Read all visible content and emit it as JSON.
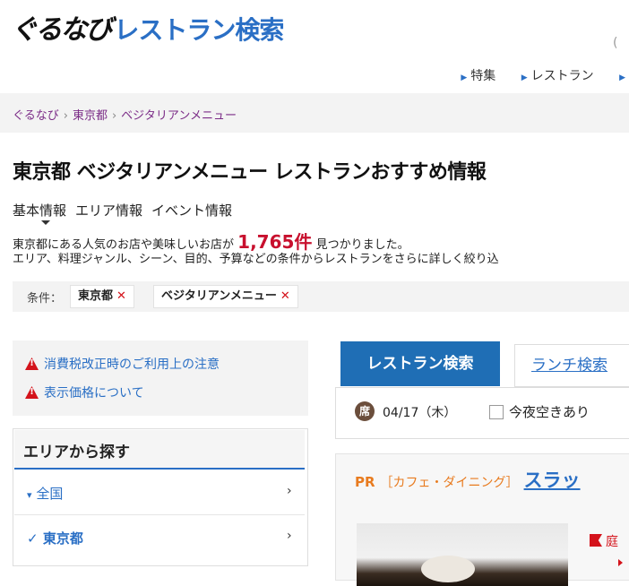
{
  "logo": {
    "brand": "ぐるなび",
    "title": "レストラン検索"
  },
  "topnav": {
    "items": [
      "特集",
      "レストラン"
    ]
  },
  "breadcrumb": [
    "ぐるなび",
    "東京都",
    "ベジタリアンメニュー"
  ],
  "page_title": "東京都 ベジタリアンメニュー レストランおすすめ情報",
  "info_tabs": [
    "基本情報",
    "エリア情報",
    "イベント情報"
  ],
  "result": {
    "prefix": "東京都にある人気のお店や美味しいお店が",
    "count": "1,765件",
    "suffix": "見つかりました。",
    "line2": "エリア、料理ジャンル、シーン、目的、予算などの条件からレストランをさらに詳しく絞り込"
  },
  "conditions": {
    "label": "条件：",
    "chips": [
      "東京都",
      "ベジタリアンメニュー"
    ],
    "remove_glyph": "✕"
  },
  "notices": [
    "消費税改正時のご利用上の注意",
    "表示価格について"
  ],
  "area_panel": {
    "heading": "エリアから探す",
    "items": [
      {
        "mark": "▾",
        "label": "全国"
      },
      {
        "mark": "✓",
        "label": "東京都"
      }
    ],
    "chevron": "›"
  },
  "search_tabs": {
    "active": "レストラン検索",
    "lunch": "ランチ検索"
  },
  "date_row": {
    "badge": "席",
    "date": "04/17（木）",
    "tonight_label": "今夜空きあり"
  },
  "pr_card": {
    "tag": "PR",
    "category": "［カフェ・ダイニング］",
    "name": "スラッ",
    "flag_text": "庭"
  },
  "colors": {
    "accent": "#2a6fc5",
    "tab": "#1f6eb5",
    "alert": "#d4131b",
    "pr": "#e87b1f",
    "breadcrumb": "#7b2c87"
  }
}
